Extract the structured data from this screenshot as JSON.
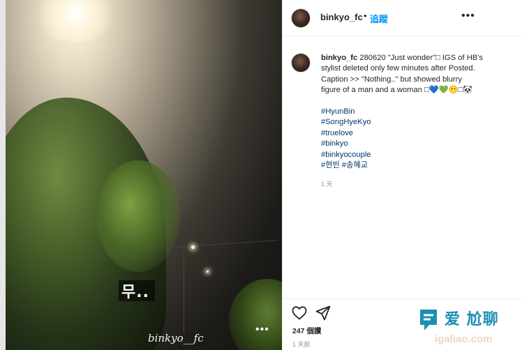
{
  "post": {
    "watermark": "binkyo__fc",
    "sticker_text": "무..",
    "photo_more_icon": "more-horizontal-icon"
  },
  "header": {
    "username": "binkyo_fc",
    "separator": "•",
    "follow_label": "追蹤",
    "more_icon": "more-horizontal-icon"
  },
  "caption": {
    "username": "binkyo_fc",
    "text": "280620 \"Just wonder\"□ IGS of HB's stylist deleted only few minutes after Posted. Caption >> \"Nothing..\" but showed blurry figure of a man and a woman □💙💚😶□🐼",
    "hashtags": [
      "#HyunBin",
      "#SongHyeKyo",
      "#truelove",
      "#binkyo",
      "#binkyocouple"
    ],
    "korean_tags": [
      "#현빈",
      "#송혜교"
    ],
    "time": "1 天"
  },
  "actions": {
    "like_icon": "heart-icon",
    "share_icon": "send-icon",
    "likes": "247 個讚",
    "time": "1 天前"
  },
  "logo": {
    "text": "爱 尬聊",
    "url": "igaliao.com"
  },
  "colors": {
    "link": "#00376b",
    "follow": "#0095f6",
    "text": "#262626",
    "muted": "#8e8e8e"
  }
}
